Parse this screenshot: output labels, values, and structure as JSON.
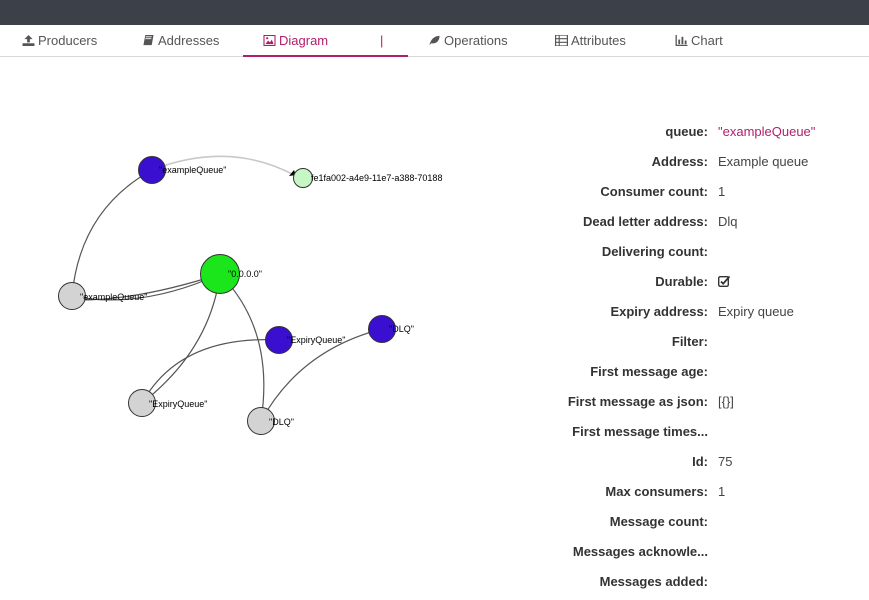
{
  "tabs": [
    {
      "label": "Producers",
      "icon": "upload-icon"
    },
    {
      "label": "Addresses",
      "icon": "book-icon"
    },
    {
      "label": "Diagram",
      "icon": "image-icon"
    },
    {
      "label": "Operations",
      "icon": "leaf-icon"
    },
    {
      "label": "Attributes",
      "icon": "list-icon"
    },
    {
      "label": "Chart",
      "icon": "bar-chart-icon"
    }
  ],
  "tab_separator": "|",
  "diagram": {
    "nodes": {
      "n1": "\"exampleQueue\"",
      "n2": "fe1fa002-a4e9-11e7-a388-70188",
      "n3": "\"0.0.0.0\"",
      "n4": "\"exampleQueue\"",
      "n5": "\"ExpiryQueue\"",
      "n6": "\"DLQ\"",
      "n7": "\"ExpiryQueue\"",
      "n8": "\"DLQ\""
    }
  },
  "properties": [
    {
      "key": "queue:",
      "value": "\"exampleQueue\""
    },
    {
      "key": "Address:",
      "value": "Example queue"
    },
    {
      "key": "Consumer count:",
      "value": "1"
    },
    {
      "key": "Dead letter address:",
      "value": "Dlq"
    },
    {
      "key": "Delivering count:",
      "value": ""
    },
    {
      "key": "Durable:",
      "value": ""
    },
    {
      "key": "Expiry address:",
      "value": "Expiry queue"
    },
    {
      "key": "Filter:",
      "value": ""
    },
    {
      "key": "First message age:",
      "value": ""
    },
    {
      "key": "First message as json:",
      "value": "[{}]"
    },
    {
      "key": "First message times...",
      "value": ""
    },
    {
      "key": "Id:",
      "value": "75"
    },
    {
      "key": "Max consumers:",
      "value": "1"
    },
    {
      "key": "Message count:",
      "value": ""
    },
    {
      "key": "Messages acknowle...",
      "value": ""
    },
    {
      "key": "Messages added:",
      "value": ""
    }
  ],
  "colors": {
    "accent": "#b01e6c",
    "topbar": "#3c4049",
    "queue_node": "#3a0fd0",
    "server_node": "#1be51b",
    "address_node": "#d3d3d3",
    "consumer_node": "#c6f5c6"
  }
}
